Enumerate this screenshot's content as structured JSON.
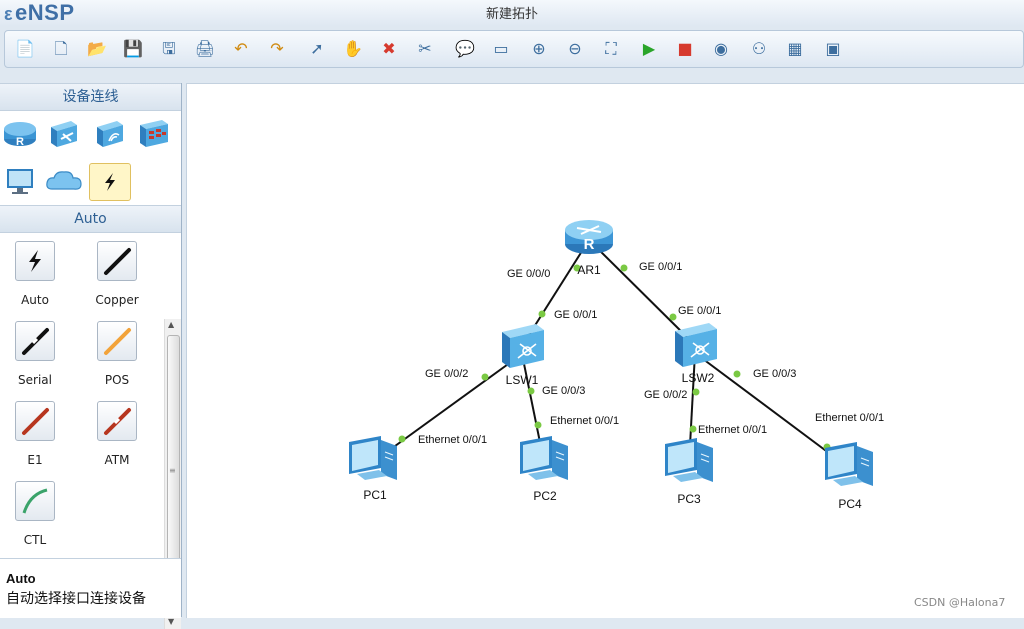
{
  "app": {
    "logo": "eNSP",
    "window_title": "新建拓扑"
  },
  "toolbar": {
    "buttons": [
      {
        "name": "new-topology",
        "icon": "new-file-icon",
        "glyph": "📄"
      },
      {
        "name": "new-blank",
        "icon": "new-blank-icon",
        "glyph": "🗋"
      },
      {
        "name": "open",
        "icon": "open-folder-icon",
        "glyph": "📂"
      },
      {
        "name": "save",
        "icon": "save-icon",
        "glyph": "💾"
      },
      {
        "name": "save-as",
        "icon": "save-as-icon",
        "glyph": "🖫"
      },
      {
        "name": "print",
        "icon": "print-icon",
        "glyph": "🖨"
      },
      {
        "name": "undo",
        "icon": "undo-icon",
        "glyph": "↶"
      },
      {
        "name": "redo",
        "icon": "redo-icon",
        "glyph": "↷"
      },
      {
        "name": "select",
        "icon": "pointer-icon",
        "glyph": "➚"
      },
      {
        "name": "pan",
        "icon": "hand-icon",
        "glyph": "✋"
      },
      {
        "name": "delete",
        "icon": "delete-x-icon",
        "glyph": "✖"
      },
      {
        "name": "delete-link",
        "icon": "delete-link-icon",
        "glyph": "✂"
      },
      {
        "name": "add-text",
        "icon": "text-box-icon",
        "glyph": "💬"
      },
      {
        "name": "add-shape",
        "icon": "rectangle-icon",
        "glyph": "▭"
      },
      {
        "name": "zoom-in",
        "icon": "zoom-in-icon",
        "glyph": "⊕"
      },
      {
        "name": "zoom-out",
        "icon": "zoom-out-icon",
        "glyph": "⊖"
      },
      {
        "name": "fit",
        "icon": "fit-view-icon",
        "glyph": "⛶"
      },
      {
        "name": "start-all",
        "icon": "play-icon",
        "glyph": "▶"
      },
      {
        "name": "stop-all",
        "icon": "stop-icon",
        "glyph": "■"
      },
      {
        "name": "capture",
        "icon": "capture-icon",
        "glyph": "◉"
      },
      {
        "name": "topology",
        "icon": "topology-icon",
        "glyph": "⚇"
      },
      {
        "name": "grid",
        "icon": "grid-icon",
        "glyph": "▦"
      },
      {
        "name": "terminal",
        "icon": "terminal-icon",
        "glyph": "▣"
      }
    ]
  },
  "left_panel": {
    "device_header": "设备连线",
    "devices": [
      {
        "icon": "router-icon"
      },
      {
        "icon": "switch-icon"
      },
      {
        "icon": "wireless-icon"
      },
      {
        "icon": "firewall-icon"
      },
      {
        "icon": "pc-icon"
      },
      {
        "icon": "cloud-icon"
      },
      {
        "icon": "cable-icon"
      }
    ],
    "cable_header": "Auto",
    "cables": [
      {
        "label": "Auto",
        "icon": "auto-cable-icon",
        "color": "#111111"
      },
      {
        "label": "Copper",
        "icon": "copper-cable-icon",
        "color": "#111111"
      },
      {
        "label": "Serial",
        "icon": "serial-cable-icon",
        "color": "#111111"
      },
      {
        "label": "POS",
        "icon": "pos-cable-icon",
        "color": "#f2a33a"
      },
      {
        "label": "E1",
        "icon": "e1-cable-icon",
        "color": "#b7361f"
      },
      {
        "label": "ATM",
        "icon": "atm-cable-icon",
        "color": "#b7361f"
      },
      {
        "label": "CTL",
        "icon": "ctl-cable-icon",
        "color": "#3aa36a"
      }
    ],
    "description": {
      "title": "Auto",
      "text": "自动选择接口连接设备"
    }
  },
  "topology": {
    "nodes": [
      {
        "id": "AR1",
        "label": "AR1",
        "type": "router"
      },
      {
        "id": "LSW1",
        "label": "LSW1",
        "type": "switch"
      },
      {
        "id": "LSW2",
        "label": "LSW2",
        "type": "switch"
      },
      {
        "id": "PC1",
        "label": "PC1",
        "type": "pc"
      },
      {
        "id": "PC2",
        "label": "PC2",
        "type": "pc"
      },
      {
        "id": "PC3",
        "label": "PC3",
        "type": "pc"
      },
      {
        "id": "PC4",
        "label": "PC4",
        "type": "pc"
      }
    ],
    "links": [
      {
        "from": "AR1",
        "from_port": "GE 0/0/0",
        "to": "LSW1",
        "to_port": "GE 0/0/1"
      },
      {
        "from": "AR1",
        "from_port": "GE 0/0/1",
        "to": "LSW2",
        "to_port": "GE 0/0/1"
      },
      {
        "from": "LSW1",
        "from_port": "GE 0/0/2",
        "to": "PC1",
        "to_port": "Ethernet 0/0/1"
      },
      {
        "from": "LSW1",
        "from_port": "GE 0/0/3",
        "to": "PC2",
        "to_port": "Ethernet 0/0/1"
      },
      {
        "from": "LSW2",
        "from_port": "GE 0/0/2",
        "to": "PC3",
        "to_port": "Ethernet 0/0/1"
      },
      {
        "from": "LSW2",
        "from_port": "GE 0/0/3",
        "to": "PC4",
        "to_port": "Ethernet 0/0/1"
      }
    ],
    "link_color": "#111111",
    "port_dot_color": "#7ac943"
  },
  "watermark": "CSDN @Halona7"
}
